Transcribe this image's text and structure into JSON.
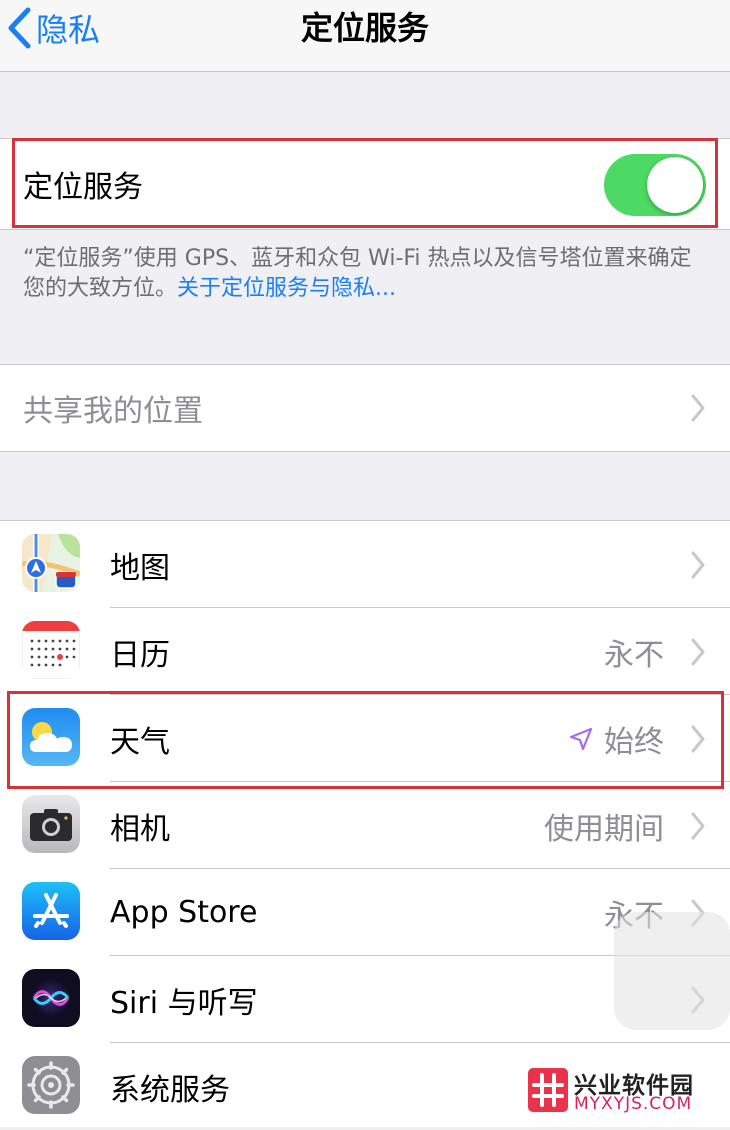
{
  "nav": {
    "back_label": "隐私",
    "title": "定位服务"
  },
  "location_services": {
    "label": "定位服务",
    "enabled": true,
    "toggle_color": "#4cd964"
  },
  "description": {
    "text": "“定位服务”使用 GPS、蓝牙和众包 Wi-Fi 热点以及信号塔位置来确定您的大致方位。",
    "link": "关于定位服务与隐私..."
  },
  "share_location": {
    "label": "共享我的位置"
  },
  "apps": [
    {
      "icon": "maps-icon",
      "label": "地图",
      "value": ""
    },
    {
      "icon": "calendar-icon",
      "label": "日历",
      "value": "永不"
    },
    {
      "icon": "weather-icon",
      "label": "天气",
      "value": "始终",
      "location_arrow": true
    },
    {
      "icon": "camera-icon",
      "label": "相机",
      "value": "使用期间"
    },
    {
      "icon": "app-store-icon",
      "label": "App Store",
      "value": "永不"
    },
    {
      "icon": "siri-icon",
      "label": "Siri 与听写",
      "value": ""
    },
    {
      "icon": "settings-gear-icon",
      "label": "系统服务",
      "value": ""
    }
  ],
  "watermark": {
    "cn": "兴业软件园",
    "en": "MYXYJS.COM"
  },
  "colors": {
    "accent": "#1a7ef5",
    "highlight": "#d9313a",
    "location_arrow": "#a56cf0"
  }
}
